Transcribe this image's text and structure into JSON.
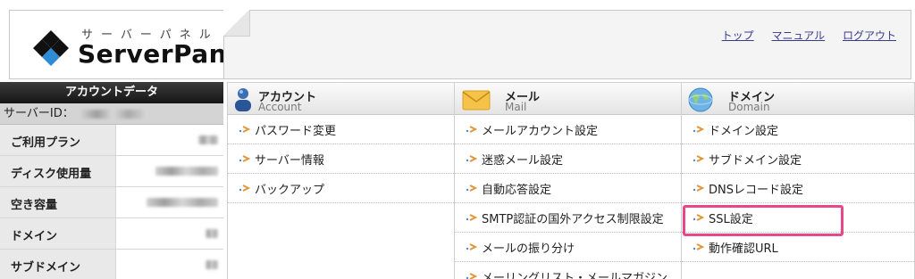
{
  "header": {
    "logo_kana": "サーバーパネル",
    "logo_text": "ServerPanel",
    "links": [
      "トップ",
      "マニュアル",
      "ログアウト"
    ]
  },
  "sidebar": {
    "title": "アカウントデータ",
    "server_id_label": "サーバーID：",
    "rows": [
      "ご利用プラン",
      "ディスク使用量",
      "空き容量",
      "ドメイン",
      "サブドメイン"
    ]
  },
  "columns": [
    {
      "title": "アカウント",
      "subtitle": "Account",
      "icon": "user-icon",
      "items": [
        "パスワード変更",
        "サーバー情報",
        "バックアップ"
      ]
    },
    {
      "title": "メール",
      "subtitle": "Mail",
      "icon": "envelope-icon",
      "items": [
        "メールアカウント設定",
        "迷惑メール設定",
        "自動応答設定",
        "SMTP認証の国外アクセス制限設定",
        "メールの振り分け",
        "メーリングリスト・メールマガジン"
      ]
    },
    {
      "title": "ドメイン",
      "subtitle": "Domain",
      "icon": "globe-icon",
      "items": [
        "ドメイン設定",
        "サブドメイン設定",
        "DNSレコード設定",
        "SSL設定",
        "動作確認URL"
      ]
    }
  ],
  "colors": {
    "highlight": "#e8478a",
    "link": "#3a3a8c",
    "sidebar_header": "#1e1e1e"
  }
}
